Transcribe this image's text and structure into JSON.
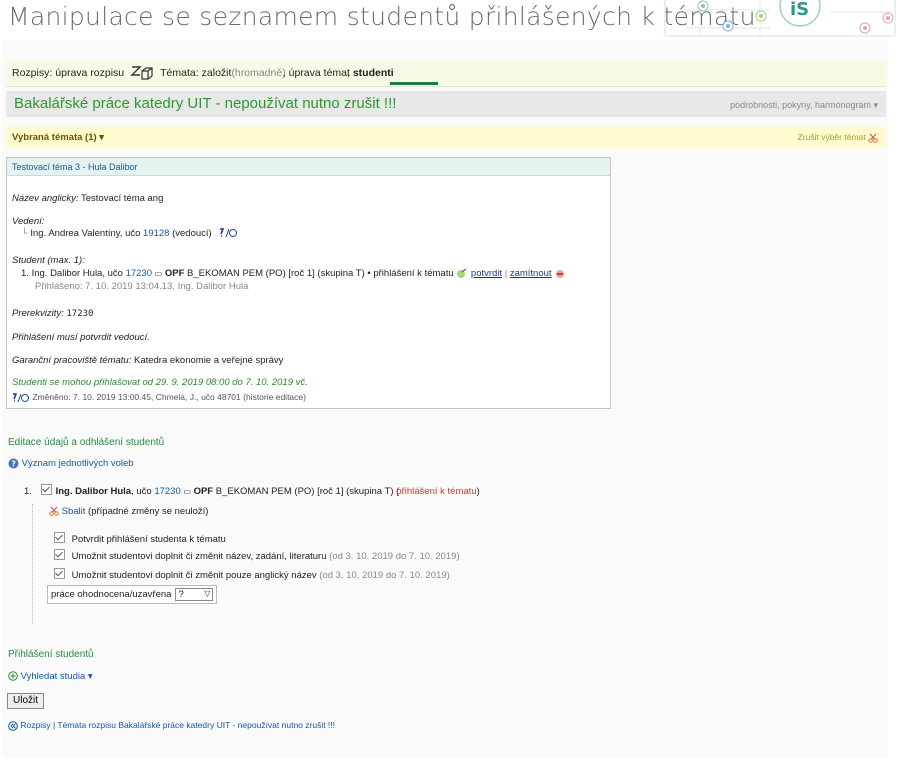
{
  "header": {
    "title": "Manipulace se seznamem studentů přihlášených k tématu",
    "logo_text": "iS"
  },
  "tabbar": {
    "prefix": "Rozpisy:",
    "edit_schedule": "úprava rozpisu",
    "topics_label": "Témata:",
    "create": "založit",
    "bulk": "(hromadně)",
    "sep": ",",
    "edit_topics": "úprava témat",
    "students": "studenti"
  },
  "course": {
    "title": "Bakalářské práce katedry UIT - nepoužívat nutno zrušit !!!",
    "links": "podrobnosti, pokyny, harmonogram ▾"
  },
  "selection": {
    "label": "Vybraná témata (1) ▾",
    "cancel": "Zrušit výběr témat"
  },
  "topic": {
    "header": "Testovací téma 3 - Hula Dalibor",
    "en_label": "Název anglicky:",
    "en_value": "Testovací téma ang",
    "supervision_label": "Vedení:",
    "supervisor_name": "Ing. Andrea Valentíny, učo",
    "supervisor_uco": "19128",
    "supervisor_role": "(vedoucí)",
    "student_label": "Student (max. 1):",
    "student_num": "1.",
    "student_name": "Ing. Dalibor Hula, učo",
    "student_uco": "17230",
    "student_faculty": "OPF",
    "student_program": "B_EKOMAN PEM (PO) [roč 1] (skupina T) • přihlášení k tématu",
    "confirm": "potvrdit",
    "pipe": "|",
    "reject": "zamítnout",
    "signed_up": "Přihlášeno: 7. 10. 2019 13:04.13, Ing. Dalibor Hula",
    "prereq_label": "Prerekvizity:",
    "prereq_value": "17230",
    "must_confirm": "Přihlášení musí potvrdit vedoucí.",
    "guarantor_label": "Garanční pracoviště tématu:",
    "guarantor_value": "Katedra ekonomie a veřejné správy",
    "signup_period": "Studenti se mohou přihlašovat od 29. 9. 2019 08:00 do 7. 10. 2019 vč.",
    "changed": "Změněno: 7. 10. 2019 13:00.45, Chmela, J., učo 48701 (historie editace)"
  },
  "edit_section": {
    "title": "Editace údajů a odhlášení studentů",
    "help_link": "Význam jednotlivých voleb",
    "num": "1.",
    "student_name": "Ing. Dalibor Hula",
    "uco_prefix": ", učo",
    "uco": "17230",
    "faculty": "OPF",
    "program": "B_EKOMAN PEM (PO) [roč 1] (skupina T)",
    "status_open": "(",
    "status_link": "přihlášení k tématu",
    "status_close": ")",
    "collapse": "Sbalit",
    "collapse_note": "(případné změny se neuloží)",
    "opt1": "Potvrdit přihlášení studenta k tématu",
    "opt2": "Umožnit studentovi doplnit či změnit název, zadání, literaturu",
    "opt2_dates": "(od 3. 10. 2019 do 7. 10. 2019)",
    "opt3": "Umožnit studentovi doplnit či změnit pouze anglický název",
    "opt3_dates": "(od 3. 10. 2019 do 7. 10. 2019)",
    "status_label": "práce ohodnocena/uzavřena",
    "status_value": "?"
  },
  "signup_section": {
    "title": "Přihlášení studentů",
    "search": "Vyhledat studia ▾",
    "save": "Uložit",
    "back_links": "Rozpisy | Témata rozpisu Bakalářské práce katedry UIT - nepoužívat nutno zrušit !!!"
  }
}
